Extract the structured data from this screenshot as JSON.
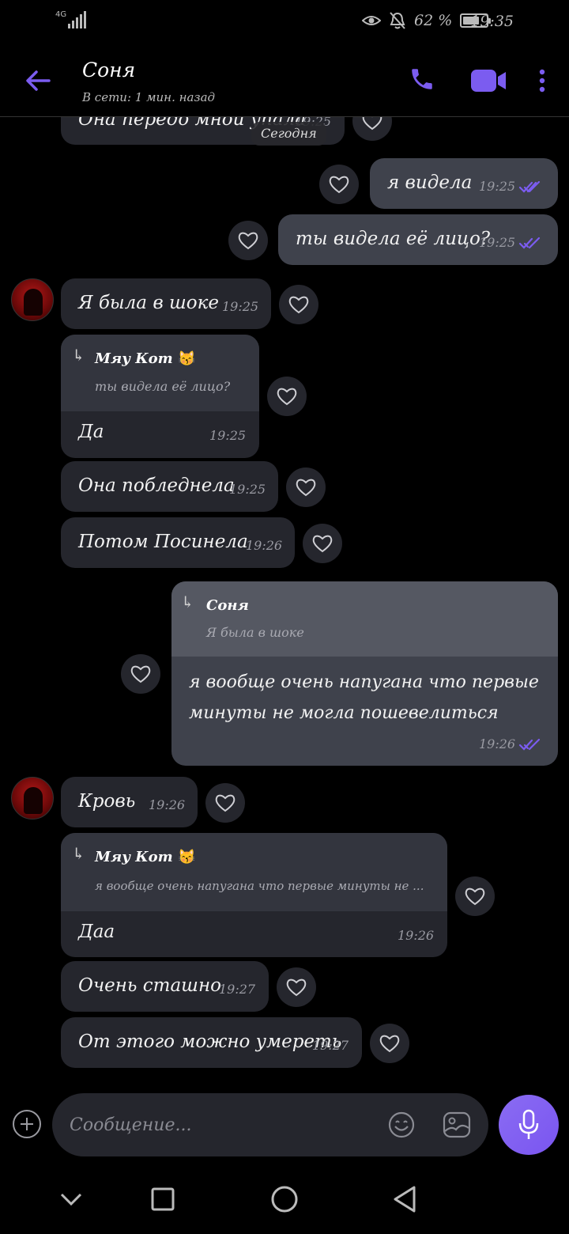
{
  "status_bar": {
    "network": "4G",
    "battery": "62 %",
    "battery_level": 0.62,
    "time": "19:35"
  },
  "header": {
    "contact_name": "Соня",
    "contact_status": "В сети: 1 мин. назад"
  },
  "chat": {
    "date_separator": "Сегодня",
    "partial_message": {
      "text": "Она передо мной упала",
      "time": "19:25"
    },
    "messages": [
      {
        "text": "я видела",
        "time": "19:25"
      },
      {
        "text": "ты видела её лицо?",
        "time": "19:25"
      },
      {
        "text": "Я была в шоке",
        "time": "19:25"
      },
      {
        "reply_name": "Мяу Кот",
        "reply_emoji": "😽",
        "reply_quote": "ты видела её лицо?",
        "text": "Да",
        "time": "19:25"
      },
      {
        "text": "Она побледнела",
        "time": "19:25"
      },
      {
        "text": "Потом Посинела",
        "time": "19:26"
      },
      {
        "reply_name": "Соня",
        "reply_quote": "Я была в шоке",
        "text_line1": "я вообще очень напугана что первые",
        "text_line2": "минуты не могла пошевелиться",
        "time": "19:26"
      },
      {
        "text": "Кровь",
        "time": "19:26"
      },
      {
        "reply_name": "Мяу Кот",
        "reply_emoji": "😽",
        "reply_quote": "я вообще очень напугана что первые минуты не ...",
        "text": "Даа",
        "time": "19:26"
      },
      {
        "text": "Очень сташно",
        "time": "19:27"
      },
      {
        "text": "От этого можно умереть",
        "time": "19:27"
      }
    ]
  },
  "composer": {
    "placeholder": "Сообщение..."
  },
  "colors": {
    "accent": "#7b5cf0",
    "incoming_bubble": "#25262d",
    "outgoing_bubble": "#3f424c",
    "background": "#000000"
  },
  "icons": [
    "back-arrow-icon",
    "phone-icon",
    "video-camera-icon",
    "more-vertical-icon",
    "heart-icon",
    "read-checkmarks-icon",
    "reply-arrow-icon",
    "plus-icon",
    "emoji-icon",
    "gallery-icon",
    "microphone-icon",
    "nav-back-icon",
    "nav-home-icon",
    "nav-recents-icon",
    "nav-collapse-icon"
  ]
}
